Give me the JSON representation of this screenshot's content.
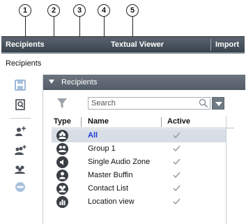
{
  "callouts": [
    "1",
    "2",
    "3",
    "4",
    "5"
  ],
  "tabs": [
    {
      "label": "Recipients"
    },
    {
      "label": "Textual Viewer"
    },
    {
      "label": "Import"
    }
  ],
  "page_label": "Recipients",
  "section": {
    "title": "Recipients"
  },
  "search": {
    "placeholder": "Search"
  },
  "table": {
    "columns": [
      "Type",
      "Name",
      "Active"
    ],
    "rows": [
      {
        "name": "All",
        "type_icon": "all-recipients-icon",
        "active": true,
        "selected": true
      },
      {
        "name": "Group 1",
        "type_icon": "group-icon",
        "active": true
      },
      {
        "name": "Single Audio Zone",
        "type_icon": "audio-zone-icon",
        "active": true
      },
      {
        "name": "Master Buffin",
        "type_icon": "person-icon",
        "active": true
      },
      {
        "name": "Contact List",
        "type_icon": "contact-list-icon",
        "active": true
      },
      {
        "name": "Location view",
        "type_icon": "location-view-icon",
        "active": true
      }
    ]
  },
  "toolbar": {
    "icons": [
      "save-icon",
      "preview-icon",
      "add-recipient-icon",
      "add-group-icon",
      "group-icon",
      "remove-icon"
    ]
  },
  "colors": {
    "tab_bar": "#3a434d",
    "section_header": "#5e6770",
    "link": "#1f3bd6",
    "selected_row": "#d7dee6",
    "toolbar_icon": "#4a76a8"
  }
}
